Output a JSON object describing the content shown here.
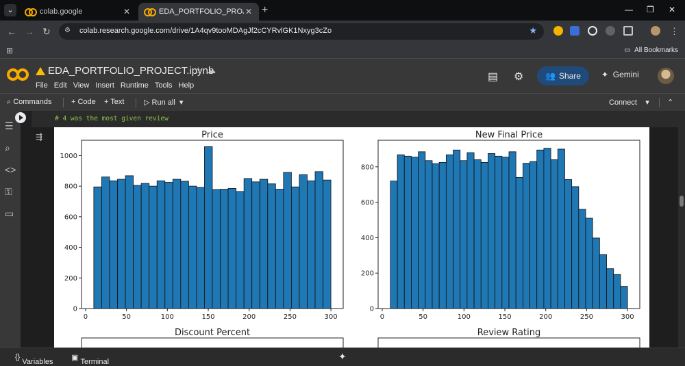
{
  "browser": {
    "tabs": [
      {
        "title": "colab.google",
        "close": "✕"
      },
      {
        "title": "EDA_PORTFOLIO_PROJECT.ipynb",
        "close": "✕"
      }
    ],
    "new_tab": "+",
    "window_controls": [
      "—",
      "❐",
      "✕"
    ],
    "url": "colab.research.google.com/drive/1A4qv9tooMDAgJf2cCYRvlGK1Nxyg3cZo",
    "bookmarks_label": "All Bookmarks"
  },
  "colab": {
    "notebook_title": "EDA_PORTFOLIO_PROJECT.ipynb",
    "menu": [
      "File",
      "Edit",
      "View",
      "Insert",
      "Runtime",
      "Tools",
      "Help"
    ],
    "share_label": "Share",
    "gemini_label": "Gemini",
    "commands_label": "Commands",
    "add_code_label": "+ Code",
    "add_text_label": "+ Text",
    "run_all_label": "Run all",
    "connect_label": "Connect",
    "code_line": "# 4 was the most given review",
    "status_variables": "Variables",
    "status_terminal": "Terminal"
  },
  "chart_data": [
    {
      "type": "bar",
      "title": "Price",
      "x": [
        15,
        25,
        35,
        45,
        55,
        65,
        75,
        85,
        95,
        105,
        115,
        125,
        135,
        145,
        155,
        165,
        175,
        185,
        195,
        205,
        215,
        225,
        235,
        245,
        255,
        265,
        275,
        285,
        295
      ],
      "values": [
        795,
        860,
        835,
        845,
        868,
        805,
        818,
        800,
        835,
        825,
        845,
        832,
        800,
        792,
        1058,
        778,
        780,
        785,
        765,
        850,
        828,
        845,
        815,
        780,
        890,
        795,
        875,
        835,
        895,
        840
      ],
      "xticks": [
        "0",
        "50",
        "100",
        "150",
        "200",
        "250",
        "300"
      ],
      "yticks": [
        "0",
        "200",
        "400",
        "600",
        "800",
        "1000"
      ],
      "xlim": [
        -5,
        315
      ],
      "ylim": [
        0,
        1100
      ]
    },
    {
      "type": "bar",
      "title": "New Final Price",
      "x": [
        10,
        15,
        20,
        25,
        30,
        35,
        40,
        45,
        50,
        55,
        60,
        65,
        70,
        75,
        80,
        85,
        90,
        95,
        100,
        105,
        110,
        115,
        120,
        125,
        130,
        135,
        140,
        145,
        150,
        155,
        160,
        165,
        170,
        175,
        180,
        185,
        190,
        195,
        200,
        205,
        210,
        215,
        220,
        225,
        230,
        235,
        240,
        245,
        250,
        255,
        260,
        265,
        270,
        275,
        280,
        285,
        290,
        295
      ],
      "values": [
        720,
        868,
        860,
        855,
        885,
        835,
        818,
        825,
        868,
        895,
        835,
        880,
        840,
        825,
        875,
        860,
        855,
        885,
        740,
        820,
        830,
        895,
        905,
        840,
        900,
        728,
        688,
        560,
        510,
        398,
        305,
        225,
        192,
        125
      ],
      "xticks": [
        "0",
        "50",
        "100",
        "150",
        "200",
        "250",
        "300"
      ],
      "yticks": [
        "0",
        "200",
        "400",
        "600",
        "800"
      ],
      "xlim": [
        -5,
        315
      ],
      "ylim": [
        0,
        950
      ]
    },
    {
      "type": "bar",
      "title": "Discount Percent",
      "values": []
    },
    {
      "type": "bar",
      "title": "Review Rating",
      "values": []
    }
  ]
}
